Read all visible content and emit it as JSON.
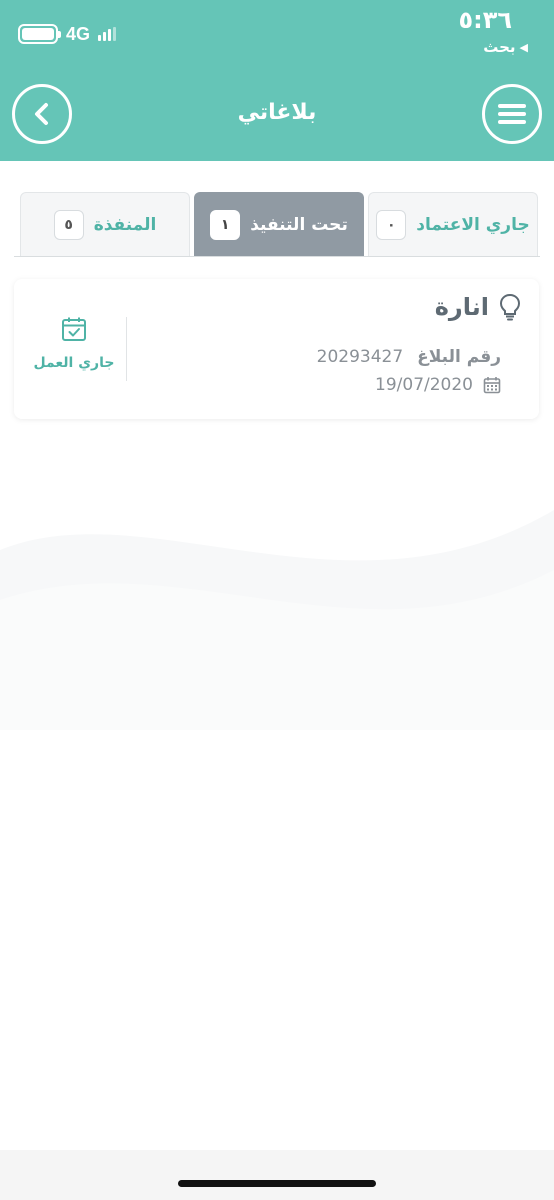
{
  "status_bar": {
    "network": "4G",
    "time": "٥:٣٦",
    "carrier": "بحث",
    "icon": "signal-icon"
  },
  "header": {
    "title": "بلاغاتي",
    "back_icon": "chevron-left-icon",
    "menu_icon": "hamburger-menu-icon",
    "background_color": "#65c5b7"
  },
  "tabs": [
    {
      "label": "جاري الاعتماد",
      "count": "٠",
      "active": false
    },
    {
      "label": "تحت التنفيذ",
      "count": "١",
      "active": true
    },
    {
      "label": "المنفذة",
      "count": "٥",
      "active": false
    }
  ],
  "report_card": {
    "title": "انارة",
    "title_icon": "lightbulb-icon",
    "number_label": "رقم البلاغ",
    "number_value": "20293427",
    "date_icon": "calendar-icon",
    "date_value": "19/07/2020",
    "status_icon": "calendar-check-icon",
    "status_label": "جاري العمل"
  },
  "colors": {
    "accent": "#65c5b7",
    "tab_active_bg": "#909aa3",
    "text_muted": "#8a9096"
  }
}
